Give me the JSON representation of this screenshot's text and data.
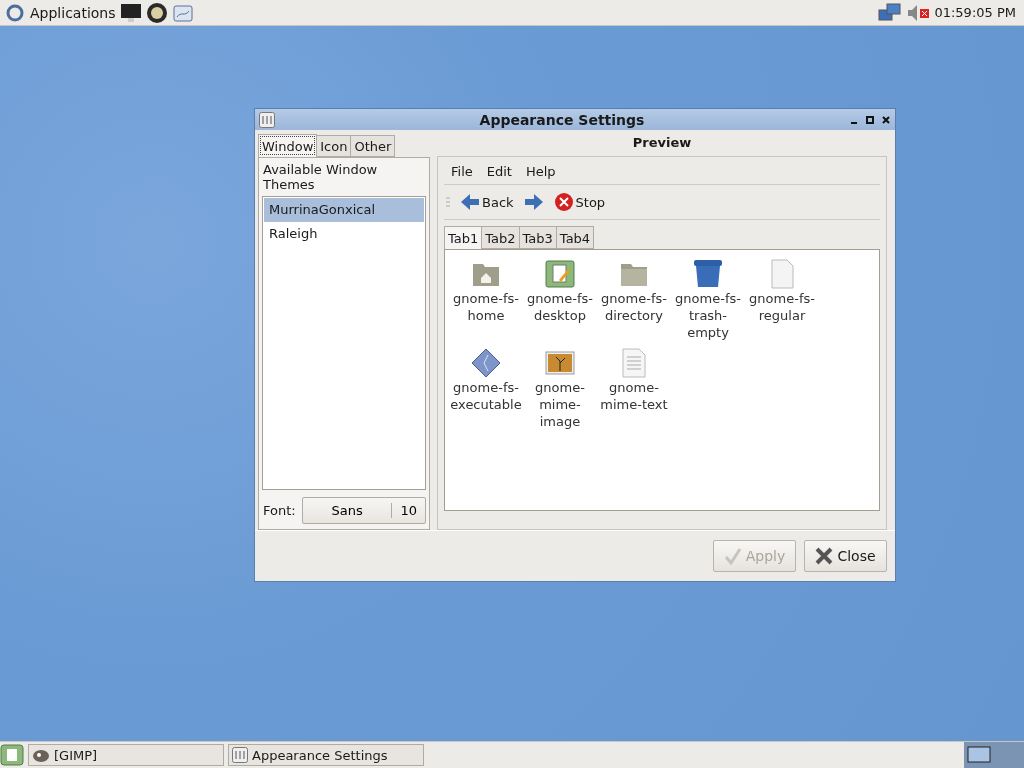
{
  "top_panel": {
    "menu": "Applications",
    "clock": "01:59:05 PM"
  },
  "window": {
    "title": "Appearance Settings",
    "tabs": [
      {
        "label": "Window",
        "selected": true
      },
      {
        "label": "Icon",
        "selected": false
      },
      {
        "label": "Other",
        "selected": false
      }
    ],
    "themes_header": "Available Window Themes",
    "themes": [
      {
        "name": "MurrinaGonxical",
        "selected": true
      },
      {
        "name": "Raleigh",
        "selected": false
      }
    ],
    "font_label": "Font:",
    "font_name": "Sans",
    "font_size": "10",
    "preview": {
      "title": "Preview",
      "menu": [
        "File",
        "Edit",
        "Help"
      ],
      "back": "Back",
      "stop": "Stop",
      "tabs": [
        {
          "label": "Tab1",
          "selected": true
        },
        {
          "label": "Tab2",
          "selected": false
        },
        {
          "label": "Tab3",
          "selected": false
        },
        {
          "label": "Tab4",
          "selected": false
        }
      ],
      "icons": [
        {
          "kind": "home",
          "label": "gnome-fs-home"
        },
        {
          "kind": "desktop",
          "label": "gnome-fs-desktop"
        },
        {
          "kind": "folder",
          "label": "gnome-fs-directory"
        },
        {
          "kind": "trash",
          "label": "gnome-fs-trash-empty"
        },
        {
          "kind": "file",
          "label": "gnome-fs-regular"
        },
        {
          "kind": "exec",
          "label": "gnome-fs-executable"
        },
        {
          "kind": "image",
          "label": "gnome-mime-image"
        },
        {
          "kind": "text",
          "label": "gnome-mime-text"
        }
      ]
    },
    "buttons": [
      {
        "kind": "apply",
        "label": "Apply",
        "disabled": true
      },
      {
        "kind": "close",
        "label": "Close",
        "disabled": false
      }
    ]
  },
  "taskbar": [
    {
      "label": "[GIMP]",
      "kind": "gimp"
    },
    {
      "label": "Appearance Settings",
      "kind": "settings"
    }
  ]
}
